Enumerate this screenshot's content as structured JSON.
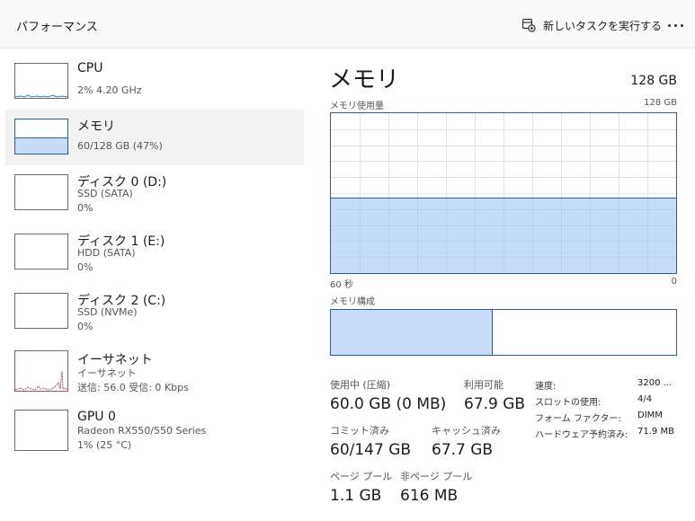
{
  "header": {
    "title": "パフォーマンス",
    "run_task_label": "新しいタスクを実行する"
  },
  "sidebar": {
    "items": [
      {
        "name": "CPU",
        "sub1": "2%  4.20 GHz",
        "sub2": ""
      },
      {
        "name": "メモリ",
        "sub1": "60/128 GB (47%)",
        "sub2": "",
        "usage_fraction": 0.47
      },
      {
        "name": "ディスク 0 (D:)",
        "sub1": "SSD (SATA)",
        "sub2": "0%"
      },
      {
        "name": "ディスク 1 (E:)",
        "sub1": "HDD (SATA)",
        "sub2": "0%"
      },
      {
        "name": "ディスク 2 (C:)",
        "sub1": "SSD (NVMe)",
        "sub2": "0%"
      },
      {
        "name": "イーサネット",
        "sub1": "イーサネット",
        "sub2": "送信: 56.0  受信: 0 Kbps"
      },
      {
        "name": "GPU 0",
        "sub1": "Radeon RX550/550 Series",
        "sub2": "1%  (25 °C)"
      }
    ]
  },
  "memory": {
    "title": "メモリ",
    "total": "128 GB",
    "usage_label": "メモリ使用量",
    "usage_max": "128 GB",
    "time_left": "60 秒",
    "time_right": "0",
    "usage_fraction": 0.47,
    "composition_label": "メモリ構成",
    "composition_used_fraction": 0.47,
    "stats": [
      {
        "label": "使用中 (圧縮)",
        "value": "60.0 GB (0 MB)"
      },
      {
        "label": "利用可能",
        "value": "67.9 GB"
      },
      {
        "label": "コミット済み",
        "value": "60/147 GB"
      },
      {
        "label": "キャッシュ済み",
        "value": "67.7 GB"
      },
      {
        "label": "ページ プール",
        "value": "1.1 GB"
      },
      {
        "label": "非ページ プール",
        "value": "616 MB"
      }
    ],
    "details": [
      {
        "label": "速度:",
        "value": "3200 ..."
      },
      {
        "label": "スロットの使用:",
        "value": "4/4"
      },
      {
        "label": "フォーム ファクター:",
        "value": "DIMM"
      },
      {
        "label": "ハードウェア予約済み:",
        "value": "71.9 MB"
      }
    ]
  },
  "colors": {
    "memory_accent": "#235fa8",
    "memory_fill": "#c8dcfa",
    "ethernet_accent": "#a34f6c"
  }
}
